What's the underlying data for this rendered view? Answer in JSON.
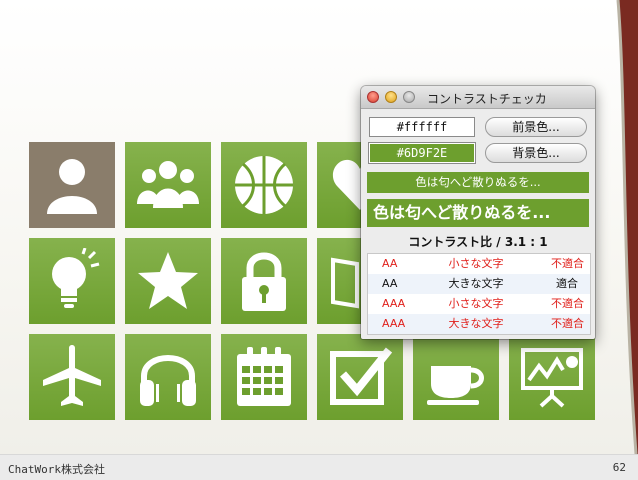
{
  "footer": {
    "brand": "ChatWork株式会社",
    "page_number": "62"
  },
  "tiles": [
    {
      "icon": "person-icon"
    },
    {
      "icon": "group-icon"
    },
    {
      "icon": "basketball-icon"
    },
    {
      "icon": "heart-icon"
    },
    {
      "icon": "lightbulb-icon"
    },
    {
      "icon": "star-icon"
    },
    {
      "icon": "lock-icon"
    },
    {
      "icon": "book-icon"
    },
    {
      "icon": "airplane-icon"
    },
    {
      "icon": "headphones-icon"
    },
    {
      "icon": "calendar-icon"
    },
    {
      "icon": "checkbox-icon"
    },
    {
      "icon": "cup-icon"
    },
    {
      "icon": "presentation-chart-icon"
    }
  ],
  "checker": {
    "title": "コントラストチェッカ",
    "foreground": {
      "value": "#ffffff",
      "button": "前景色..."
    },
    "background": {
      "value": "#6D9F2E",
      "button": "背景色..."
    },
    "preview_text_small": "色は匂へど散りぬるを...",
    "preview_text_large": "色は匂へど散りぬるを...",
    "ratio_text": "コントラスト比 / 3.1 : 1",
    "results": [
      {
        "level": "AA",
        "size": "小さな文字",
        "result": "不適合",
        "status": "fail"
      },
      {
        "level": "AA",
        "size": "大きな文字",
        "result": "適合",
        "status": "pass"
      },
      {
        "level": "AAA",
        "size": "小さな文字",
        "result": "不適合",
        "status": "fail"
      },
      {
        "level": "AAA",
        "size": "大きな文字",
        "result": "不適合",
        "status": "fail"
      }
    ]
  },
  "colors": {
    "tile_green": "#6d9f2e",
    "selected_tile": "#8a7d6b",
    "fail_red": "#e0201b",
    "footer_bg": "#ebebeb"
  }
}
